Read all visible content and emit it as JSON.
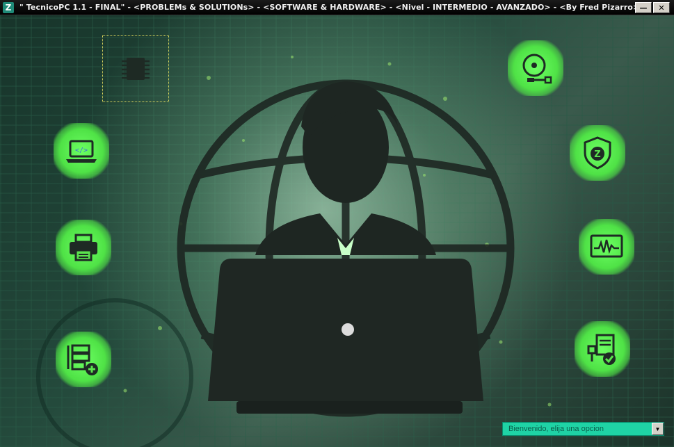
{
  "window": {
    "title": "\" TecnicoPC 1.1 - FINAL\"  -  <PROBLEMs & SOLUTIONs>   -   <SOFTWARE & HARDWARE>   -   <Nivel - INTERMEDIO - AVANZADO>   -  <By Fred Pizarro>",
    "app_icon_glyph": "Z",
    "minimize_glyph": "—",
    "close_glyph": "✕"
  },
  "left_icons": [
    {
      "icon": "microchip-icon",
      "selected": true
    },
    {
      "icon": "laptop-code-icon"
    },
    {
      "icon": "printer-icon"
    },
    {
      "icon": "server-add-icon"
    }
  ],
  "right_icons": [
    {
      "icon": "disc-usb-icon"
    },
    {
      "icon": "shield-z-icon",
      "glyph": "Z"
    },
    {
      "icon": "monitor-waveform-icon"
    },
    {
      "icon": "server-check-icon"
    }
  ],
  "status_dropdown": {
    "value": "Bienvenido, elija una opcion",
    "arrow": "▼"
  },
  "colors": {
    "accent_green": "#5be34e",
    "status_teal": "#1fd3a5",
    "icon_dark": "#1e2a24"
  }
}
